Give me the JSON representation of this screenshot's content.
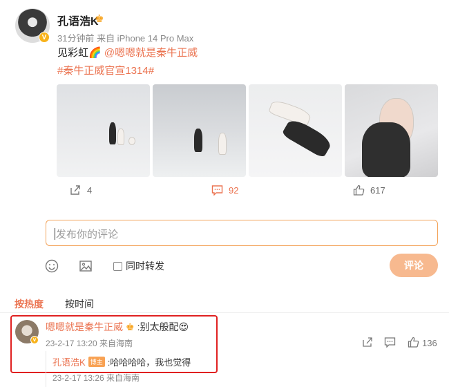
{
  "post": {
    "author": "孔语浩K",
    "crown_icon": "crown-icon",
    "verified_icon": "v-badge-icon",
    "meta": "31分钟前 来自 iPhone 14 Pro Max",
    "text_prefix": "见彩虹🌈 ",
    "mention": "@嗯嗯就是秦牛正威",
    "hashtag": "#秦牛正威官宣1314#"
  },
  "actions": {
    "repost_count": "4",
    "comment_count": "92",
    "like_count": "617"
  },
  "comment_input": {
    "placeholder": "发布你的评论",
    "repost_label": "同时转发",
    "submit_label": "评论"
  },
  "sort": {
    "hot": "按热度",
    "time": "按时间"
  },
  "comment": {
    "author": "嗯嗯就是秦牛正威",
    "text": ":别太般配😍",
    "meta": "23-2-17 13:20 来自海南",
    "like_count": "136",
    "reply": {
      "author": "孔语浩K",
      "tag": "博主",
      "text": ":哈哈哈哈，我也觉得",
      "meta": "23-2-17 13:26 来自海南"
    }
  },
  "colors": {
    "accent": "#eb7350",
    "submit_bg": "#f7b98f",
    "highlight_border": "#e02020"
  }
}
